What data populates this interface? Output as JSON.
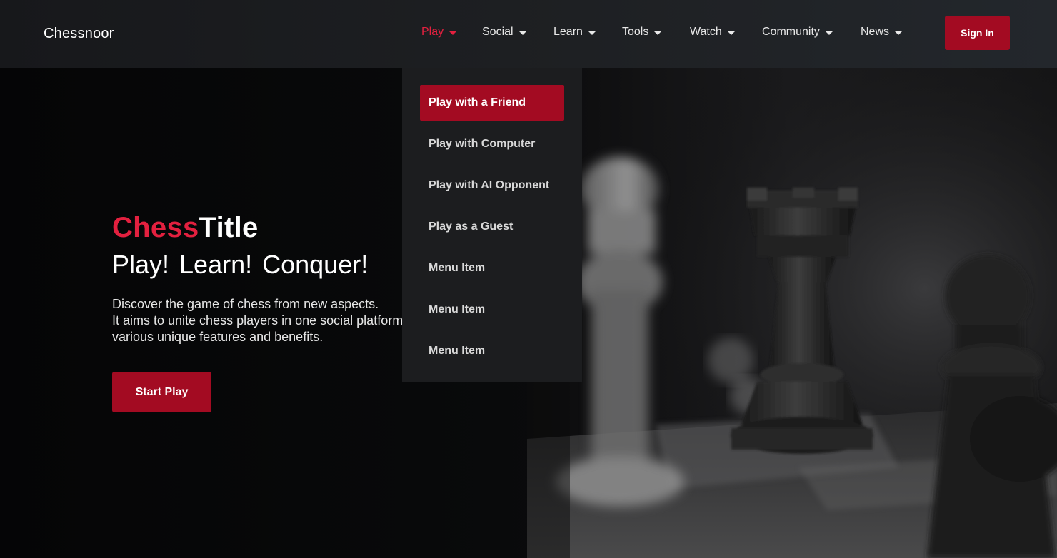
{
  "header": {
    "logo": "Chessnoor",
    "nav": [
      {
        "label": "Play",
        "active": true
      },
      {
        "label": "Social",
        "active": false
      },
      {
        "label": "Learn",
        "active": false
      },
      {
        "label": "Tools",
        "active": false
      },
      {
        "label": "Watch",
        "active": false
      },
      {
        "label": "Community",
        "active": false
      },
      {
        "label": "News",
        "active": false
      }
    ],
    "sign_in": "Sign In"
  },
  "dropdown": {
    "items": [
      {
        "label": "Play with a Friend",
        "selected": true
      },
      {
        "label": "Play with Computer",
        "selected": false
      },
      {
        "label": "Play with AI Opponent",
        "selected": false
      },
      {
        "label": "Play as a Guest",
        "selected": false
      },
      {
        "label": "Menu Item",
        "selected": false
      },
      {
        "label": "Menu Item",
        "selected": false
      },
      {
        "label": "Menu Item",
        "selected": false
      }
    ]
  },
  "hero": {
    "title_accent": "Chess",
    "title_rest": "Title",
    "subtitle": "Play!  Learn!  Conquer!",
    "description": [
      "Discover the game of chess from new aspects.",
      "It aims to unite chess players in one social platform with",
      "various unique features and benefits."
    ],
    "cta": "Start Play",
    "image_icon": "chess-rook-photo"
  },
  "colors": {
    "accent": "#e3203f",
    "button": "#a30b22",
    "header_bg": "#1e2023",
    "dropdown_bg": "#1c1d1f"
  }
}
